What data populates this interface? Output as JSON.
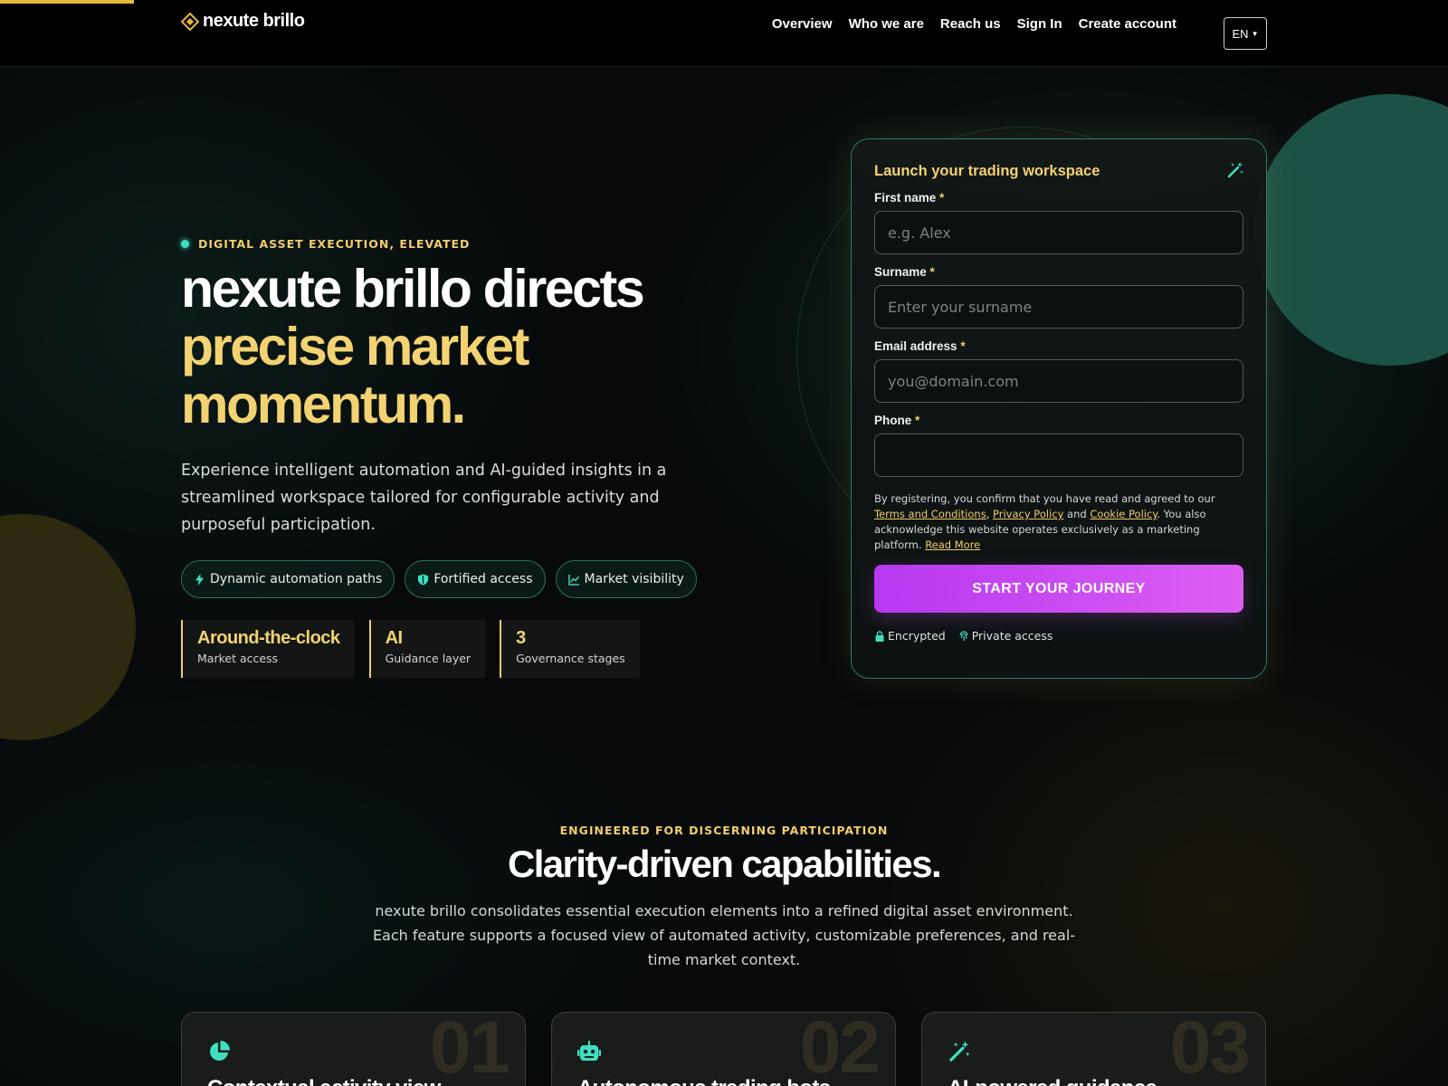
{
  "header": {
    "brand": "nexute brillo",
    "nav": [
      "Overview",
      "Who we are",
      "Reach us",
      "Sign In",
      "Create account"
    ],
    "language": "EN"
  },
  "hero": {
    "eyebrow": "DIGITAL ASSET EXECUTION, ELEVATED",
    "headline_plain": "nexute brillo directs ",
    "headline_highlight": "precise market momentum.",
    "lede": "Experience intelligent automation and AI-guided insights in a streamlined workspace tailored for configurable activity and purposeful participation.",
    "pills": [
      {
        "label": "Dynamic automation paths",
        "icon": "bolt-icon"
      },
      {
        "label": "Fortified access",
        "icon": "shield-icon"
      },
      {
        "label": "Market visibility",
        "icon": "chart-line-icon"
      }
    ],
    "stats": [
      {
        "value": "Around-the-clock",
        "label": "Market access"
      },
      {
        "value": "AI",
        "label": "Guidance layer"
      },
      {
        "value": "3",
        "label": "Governance stages"
      }
    ]
  },
  "form": {
    "title": "Launch your trading workspace",
    "fields": [
      {
        "label": "First name",
        "required_mark": "*",
        "placeholder": "e.g. Alex",
        "value": ""
      },
      {
        "label": "Surname",
        "required_mark": "*",
        "placeholder": "Enter your surname",
        "value": ""
      },
      {
        "label": "Email address",
        "required_mark": "*",
        "placeholder": "you@domain.com",
        "value": ""
      },
      {
        "label": "Phone",
        "required_mark": "*",
        "placeholder": "",
        "value": ""
      }
    ],
    "terms": {
      "prefix": "By registering, you confirm that you have read and agreed to our ",
      "terms_link": "Terms and Conditions",
      "sep1": ", ",
      "privacy_link": "Privacy Policy",
      "and": " and ",
      "cookie_link": "Cookie Policy",
      "suffix": ". You also acknowledge this website operates exclusively as a marketing platform. ",
      "read_more": "Read More"
    },
    "submit": "START YOUR JOURNEY",
    "badges": [
      "Encrypted",
      "Private access"
    ]
  },
  "features": {
    "kicker": "ENGINEERED FOR DISCERNING PARTICIPATION",
    "title": "Clarity-driven capabilities.",
    "description": "nexute brillo consolidates essential execution elements into a refined digital asset environment. Each feature supports a focused view of automated activity, customizable preferences, and real-time market context.",
    "cards": [
      {
        "num": "01",
        "title": "Contextual activity view",
        "icon": "pie-chart-icon"
      },
      {
        "num": "02",
        "title": "Autonomous trading bots",
        "icon": "robot-icon"
      },
      {
        "num": "03",
        "title": "AI-powered guidance",
        "icon": "magic-wand-icon"
      }
    ]
  },
  "colors": {
    "accent_gold": "#f3d272",
    "accent_teal": "#3fe0c0",
    "cta_gradient_start": "#b638f0",
    "cta_gradient_end": "#de5ef3"
  }
}
